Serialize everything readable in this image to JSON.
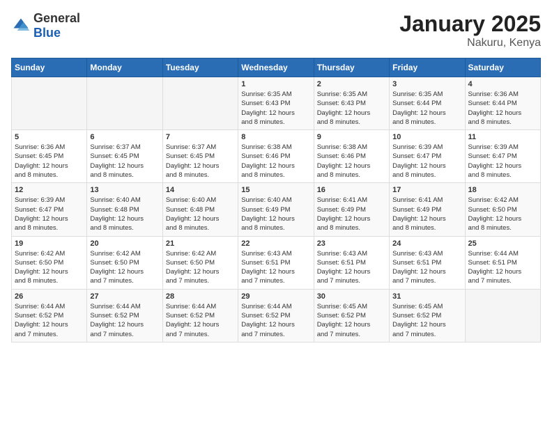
{
  "logo": {
    "general": "General",
    "blue": "Blue"
  },
  "title": "January 2025",
  "subtitle": "Nakuru, Kenya",
  "weekdays": [
    "Sunday",
    "Monday",
    "Tuesday",
    "Wednesday",
    "Thursday",
    "Friday",
    "Saturday"
  ],
  "weeks": [
    [
      {
        "day": "",
        "info": ""
      },
      {
        "day": "",
        "info": ""
      },
      {
        "day": "",
        "info": ""
      },
      {
        "day": "1",
        "info": "Sunrise: 6:35 AM\nSunset: 6:43 PM\nDaylight: 12 hours\nand 8 minutes."
      },
      {
        "day": "2",
        "info": "Sunrise: 6:35 AM\nSunset: 6:43 PM\nDaylight: 12 hours\nand 8 minutes."
      },
      {
        "day": "3",
        "info": "Sunrise: 6:35 AM\nSunset: 6:44 PM\nDaylight: 12 hours\nand 8 minutes."
      },
      {
        "day": "4",
        "info": "Sunrise: 6:36 AM\nSunset: 6:44 PM\nDaylight: 12 hours\nand 8 minutes."
      }
    ],
    [
      {
        "day": "5",
        "info": "Sunrise: 6:36 AM\nSunset: 6:45 PM\nDaylight: 12 hours\nand 8 minutes."
      },
      {
        "day": "6",
        "info": "Sunrise: 6:37 AM\nSunset: 6:45 PM\nDaylight: 12 hours\nand 8 minutes."
      },
      {
        "day": "7",
        "info": "Sunrise: 6:37 AM\nSunset: 6:45 PM\nDaylight: 12 hours\nand 8 minutes."
      },
      {
        "day": "8",
        "info": "Sunrise: 6:38 AM\nSunset: 6:46 PM\nDaylight: 12 hours\nand 8 minutes."
      },
      {
        "day": "9",
        "info": "Sunrise: 6:38 AM\nSunset: 6:46 PM\nDaylight: 12 hours\nand 8 minutes."
      },
      {
        "day": "10",
        "info": "Sunrise: 6:39 AM\nSunset: 6:47 PM\nDaylight: 12 hours\nand 8 minutes."
      },
      {
        "day": "11",
        "info": "Sunrise: 6:39 AM\nSunset: 6:47 PM\nDaylight: 12 hours\nand 8 minutes."
      }
    ],
    [
      {
        "day": "12",
        "info": "Sunrise: 6:39 AM\nSunset: 6:47 PM\nDaylight: 12 hours\nand 8 minutes."
      },
      {
        "day": "13",
        "info": "Sunrise: 6:40 AM\nSunset: 6:48 PM\nDaylight: 12 hours\nand 8 minutes."
      },
      {
        "day": "14",
        "info": "Sunrise: 6:40 AM\nSunset: 6:48 PM\nDaylight: 12 hours\nand 8 minutes."
      },
      {
        "day": "15",
        "info": "Sunrise: 6:40 AM\nSunset: 6:49 PM\nDaylight: 12 hours\nand 8 minutes."
      },
      {
        "day": "16",
        "info": "Sunrise: 6:41 AM\nSunset: 6:49 PM\nDaylight: 12 hours\nand 8 minutes."
      },
      {
        "day": "17",
        "info": "Sunrise: 6:41 AM\nSunset: 6:49 PM\nDaylight: 12 hours\nand 8 minutes."
      },
      {
        "day": "18",
        "info": "Sunrise: 6:42 AM\nSunset: 6:50 PM\nDaylight: 12 hours\nand 8 minutes."
      }
    ],
    [
      {
        "day": "19",
        "info": "Sunrise: 6:42 AM\nSunset: 6:50 PM\nDaylight: 12 hours\nand 8 minutes."
      },
      {
        "day": "20",
        "info": "Sunrise: 6:42 AM\nSunset: 6:50 PM\nDaylight: 12 hours\nand 7 minutes."
      },
      {
        "day": "21",
        "info": "Sunrise: 6:42 AM\nSunset: 6:50 PM\nDaylight: 12 hours\nand 7 minutes."
      },
      {
        "day": "22",
        "info": "Sunrise: 6:43 AM\nSunset: 6:51 PM\nDaylight: 12 hours\nand 7 minutes."
      },
      {
        "day": "23",
        "info": "Sunrise: 6:43 AM\nSunset: 6:51 PM\nDaylight: 12 hours\nand 7 minutes."
      },
      {
        "day": "24",
        "info": "Sunrise: 6:43 AM\nSunset: 6:51 PM\nDaylight: 12 hours\nand 7 minutes."
      },
      {
        "day": "25",
        "info": "Sunrise: 6:44 AM\nSunset: 6:51 PM\nDaylight: 12 hours\nand 7 minutes."
      }
    ],
    [
      {
        "day": "26",
        "info": "Sunrise: 6:44 AM\nSunset: 6:52 PM\nDaylight: 12 hours\nand 7 minutes."
      },
      {
        "day": "27",
        "info": "Sunrise: 6:44 AM\nSunset: 6:52 PM\nDaylight: 12 hours\nand 7 minutes."
      },
      {
        "day": "28",
        "info": "Sunrise: 6:44 AM\nSunset: 6:52 PM\nDaylight: 12 hours\nand 7 minutes."
      },
      {
        "day": "29",
        "info": "Sunrise: 6:44 AM\nSunset: 6:52 PM\nDaylight: 12 hours\nand 7 minutes."
      },
      {
        "day": "30",
        "info": "Sunrise: 6:45 AM\nSunset: 6:52 PM\nDaylight: 12 hours\nand 7 minutes."
      },
      {
        "day": "31",
        "info": "Sunrise: 6:45 AM\nSunset: 6:52 PM\nDaylight: 12 hours\nand 7 minutes."
      },
      {
        "day": "",
        "info": ""
      }
    ]
  ]
}
